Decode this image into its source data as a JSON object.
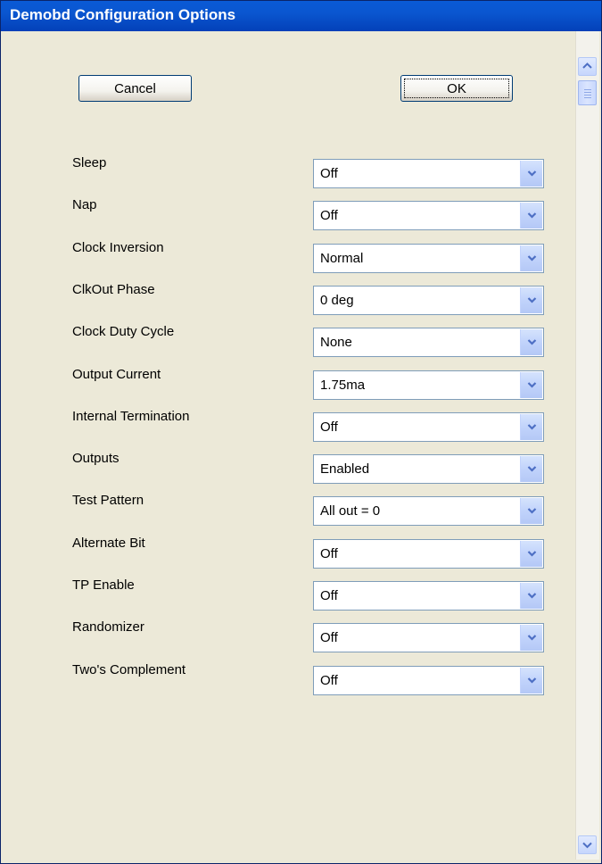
{
  "window": {
    "title": "Demobd Configuration Options"
  },
  "buttons": {
    "cancel": "Cancel",
    "ok": "OK"
  },
  "options": [
    {
      "label": "Sleep",
      "value": "Off"
    },
    {
      "label": "Nap",
      "value": "Off"
    },
    {
      "label": "Clock Inversion",
      "value": "Normal"
    },
    {
      "label": "ClkOut Phase",
      "value": "0 deg"
    },
    {
      "label": "Clock Duty Cycle",
      "value": "None"
    },
    {
      "label": "Output Current",
      "value": "1.75ma"
    },
    {
      "label": "Internal Termination",
      "value": "Off"
    },
    {
      "label": "Outputs",
      "value": "Enabled"
    },
    {
      "label": "Test Pattern",
      "value": "All out = 0"
    },
    {
      "label": "Alternate Bit",
      "value": "Off"
    },
    {
      "label": "TP Enable",
      "value": "Off"
    },
    {
      "label": "Randomizer",
      "value": "Off"
    },
    {
      "label": "Two's Complement",
      "value": "Off"
    }
  ],
  "icons": {
    "dropdown": "chevron-down-icon",
    "scroll_up": "chevron-up-icon",
    "scroll_down": "chevron-down-icon"
  },
  "colors": {
    "titlebar": "#0a56d0",
    "background": "#ece9d8",
    "accent": "#4d6fc4"
  }
}
